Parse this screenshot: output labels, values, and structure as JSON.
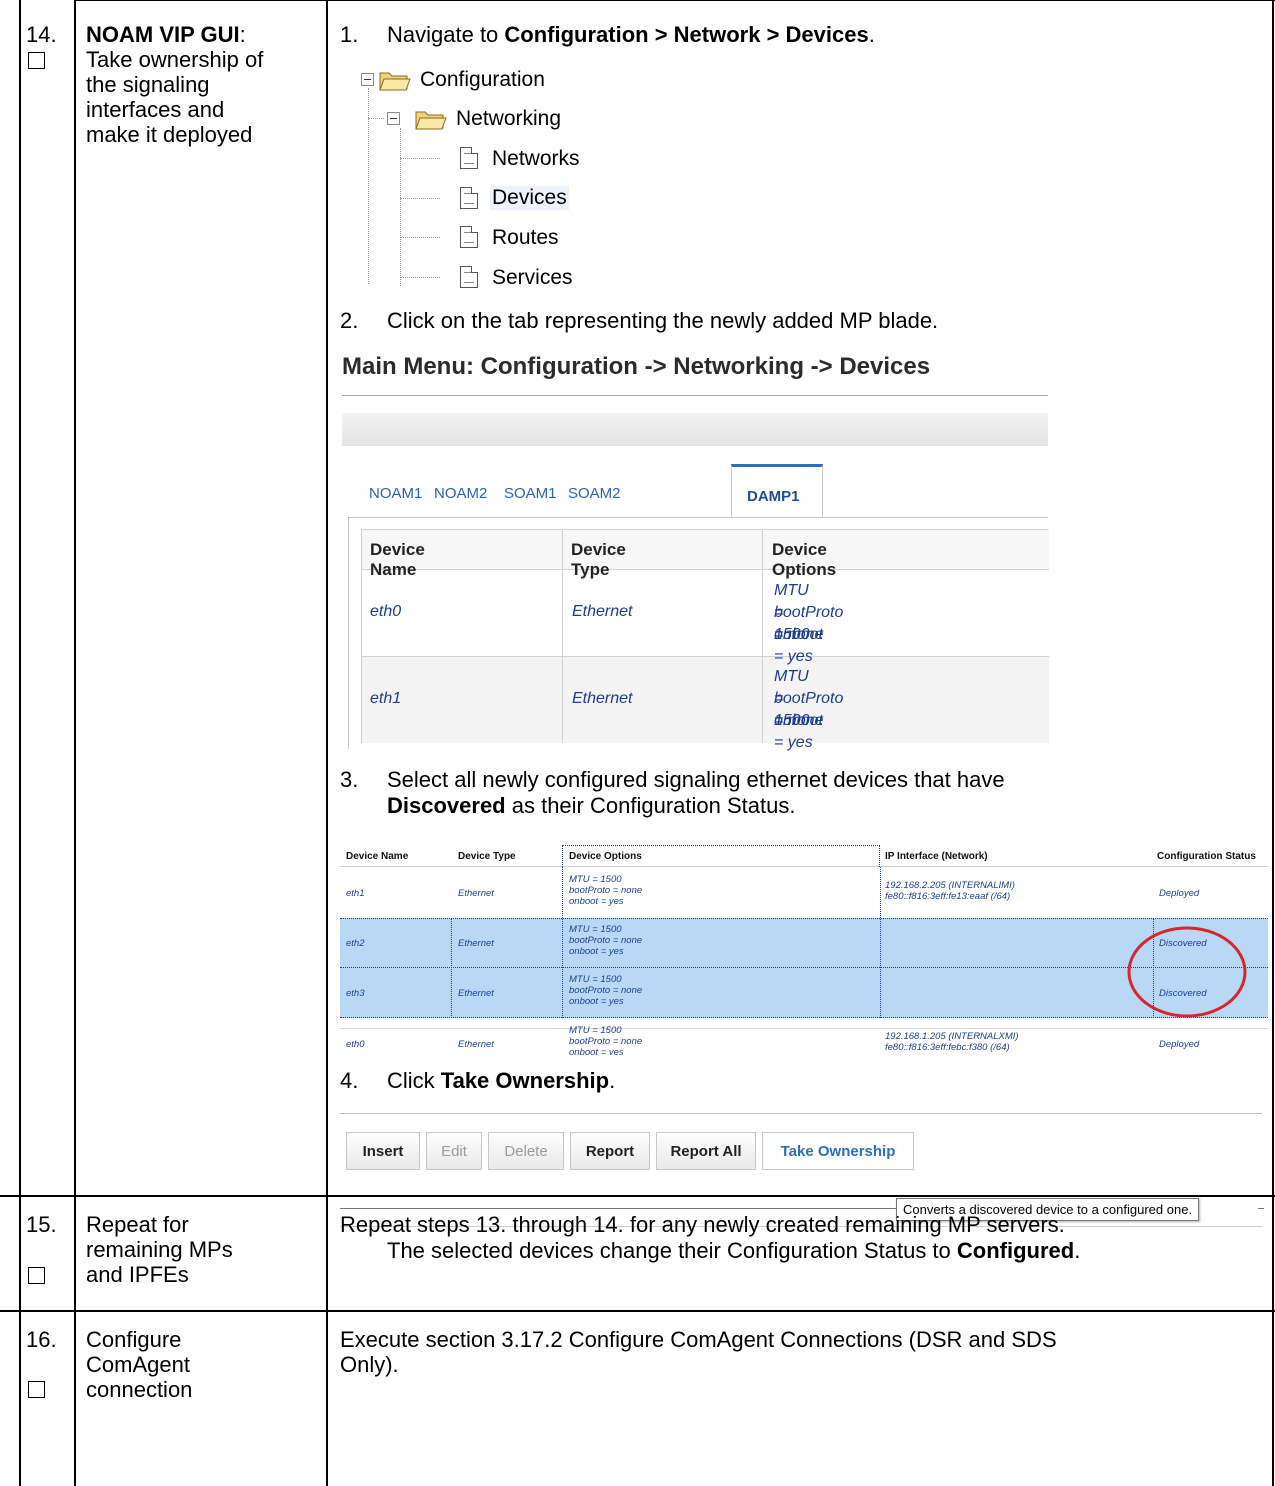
{
  "rows": [
    {
      "step": "14.",
      "title_bold": "NOAM VIP GUI",
      "title_colon": ":",
      "title_lines": [
        "Take ownership of",
        "the signaling",
        "interfaces and",
        "make it deployed"
      ]
    },
    {
      "step": "15.",
      "title_lines": [
        "Repeat for",
        "remaining MPs",
        "and IPFEs"
      ],
      "body": "Repeat steps 13. through 14. for any newly created remaining MP servers."
    },
    {
      "step": "16.",
      "title_lines": [
        "Configure",
        "ComAgent",
        "connection"
      ],
      "body_line1": "Execute section 3.17.2 Configure ComAgent Connections (DSR and SDS",
      "body_line2": "Only)."
    }
  ],
  "step1": {
    "num": "1.",
    "pre": "Navigate to ",
    "bold": "Configuration > Network > Devices",
    "post": "."
  },
  "tree": {
    "root": "Configuration",
    "child": "Networking",
    "leaves": [
      "Networks",
      "Devices",
      "Routes",
      "Services"
    ]
  },
  "step2": {
    "num": "2.",
    "text": "Click on the tab representing the newly added MP blade."
  },
  "screen1": {
    "title": "Main Menu: Configuration -> Networking -> Devices",
    "tabs": [
      "NOAM1",
      "NOAM2",
      "SOAM1",
      "SOAM2",
      "DAMP1"
    ],
    "headers": [
      "Device Name",
      "Device Type",
      "Device Options"
    ],
    "rows": [
      {
        "name": "eth0",
        "type": "Ethernet",
        "opt1": "MTU = 1500",
        "opt2": "bootProto = none",
        "opt3": "onboot = yes"
      },
      {
        "name": "eth1",
        "type": "Ethernet",
        "opt1": "MTU = 1500",
        "opt2": "bootProto = none",
        "opt3": "onboot = yes"
      }
    ]
  },
  "step3": {
    "num": "3.",
    "line1": "Select all newly configured signaling ethernet devices that have",
    "bold": "Discovered",
    "line2_rest": " as their Configuration Status."
  },
  "screen2": {
    "headers": [
      "Device Name",
      "Device Type",
      "Device Options",
      "IP Interface (Network)",
      "Configuration Status"
    ],
    "rows": [
      {
        "name": "eth1",
        "type": "Ethernet",
        "opt1": "MTU = 1500",
        "opt2": "bootProto = none",
        "opt3": "onboot = yes",
        "ip1": "192.168.2.205 (INTERNALIMI)",
        "ip2": "fe80::f816:3eff:fe13:eaaf (/64)",
        "status": "Deployed"
      },
      {
        "name": "eth2",
        "type": "Ethernet",
        "opt1": "MTU = 1500",
        "opt2": "bootProto = none",
        "opt3": "onboot = yes",
        "ip1": "",
        "ip2": "",
        "status": "Discovered"
      },
      {
        "name": "eth3",
        "type": "Ethernet",
        "opt1": "MTU = 1500",
        "opt2": "bootProto = none",
        "opt3": "onboot = yes",
        "ip1": "",
        "ip2": "",
        "status": "Discovered"
      },
      {
        "name": "eth0",
        "type": "Ethernet",
        "opt1": "MTU = 1500",
        "opt2": "bootProto = none",
        "opt3": "onboot = yes",
        "ip1": "192.168.1.205 (INTERNALXMI)",
        "ip2": "fe80::f816:3eff:febc:f380 (/64)",
        "status": "Deployed"
      }
    ],
    "highlight_color": "#b8d8f5",
    "circle_color": "#d8262c"
  },
  "step4": {
    "num": "4.",
    "pre": "Click ",
    "bold": "Take Ownership",
    "post": "."
  },
  "buttons": [
    "Insert",
    "Edit",
    "Delete",
    "Report",
    "Report All",
    "Take Ownership"
  ],
  "tooltip": "Converts a discovered device to a configured one.",
  "result": {
    "pre": "The selected devices change their Configuration Status to ",
    "bold": "Configured",
    "post": "."
  }
}
